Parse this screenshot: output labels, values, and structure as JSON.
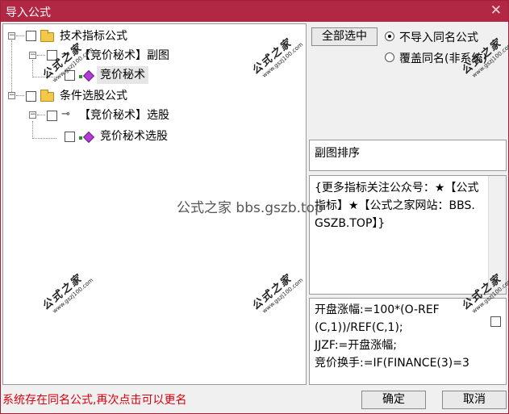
{
  "window": {
    "title": "导入公式",
    "close_glyph": "✕"
  },
  "tree": {
    "root1": {
      "label": "技术指标公式",
      "expander": "−"
    },
    "child1": {
      "label": "【竞价秘术】副图",
      "expander": "−"
    },
    "leaf1": {
      "label": "竞价秘术"
    },
    "root2": {
      "label": "条件选股公式",
      "expander": "−"
    },
    "child2": {
      "label": "【竞价秘术】选股",
      "expander": "−"
    },
    "leaf2": {
      "label": "竞价秘术选股"
    }
  },
  "options": {
    "select_all_label": "全部选中",
    "radio_skip_label": "不导入同名公式",
    "radio_overwrite_label": "覆盖同名(非系统)"
  },
  "sort_panel": {
    "label": "副图排序"
  },
  "description": {
    "text": "{更多指标关注公众号：★【公式指标】★【公式之家网站：BBS.GSZB.TOP】}"
  },
  "formula": {
    "line1": "开盘涨幅:=100*(O-REF",
    "line2": "(C,1))/REF(C,1);",
    "line3": "JJZF:=开盘涨幅;",
    "line4": "竞价换手:=IF(FINANCE(3)=3"
  },
  "status_message": "系统存在同名公式,再次点击可以更名",
  "buttons": {
    "ok_label": "确定",
    "cancel_label": "取消"
  },
  "watermark": {
    "brand": "公式之家",
    "url": "www.gszj100.com",
    "center": "公式之家 bbs.gszb.top"
  },
  "colors": {
    "titlebar": "#b22844",
    "status_text": "#d9000f"
  }
}
